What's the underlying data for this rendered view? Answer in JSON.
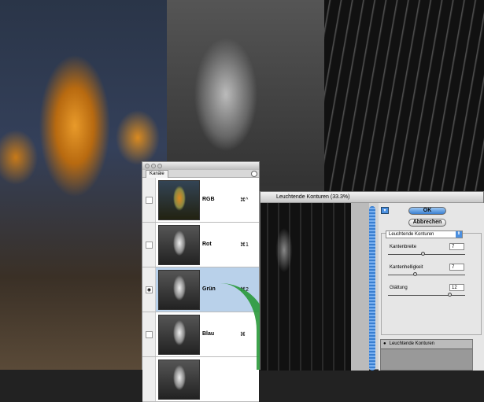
{
  "channels_panel": {
    "tab_label": "Kanäle",
    "channels": [
      {
        "name": "RGB",
        "shortcut": "⌘^",
        "visible": false,
        "selected": false
      },
      {
        "name": "Rot",
        "shortcut": "⌘1",
        "visible": false,
        "selected": false
      },
      {
        "name": "Grün",
        "shortcut": "⌘2",
        "visible": true,
        "selected": true
      },
      {
        "name": "Blau",
        "shortcut": "⌘",
        "visible": false,
        "selected": false
      }
    ]
  },
  "filter_dialog": {
    "title": "Leuchtende Konturen (33.3%)",
    "ok_label": "OK",
    "cancel_label": "Abbrechen",
    "filter_select": "Leuchtende Konturen",
    "params": [
      {
        "label": "Kantenbreite",
        "value": "7",
        "fraction": 0.45
      },
      {
        "label": "Kantenhelligkeit",
        "value": "7",
        "fraction": 0.35
      },
      {
        "label": "Glättung",
        "value": "12",
        "fraction": 0.8
      }
    ],
    "layer_name": "Leuchtende Konturen",
    "accent": "#3a7fd0"
  }
}
